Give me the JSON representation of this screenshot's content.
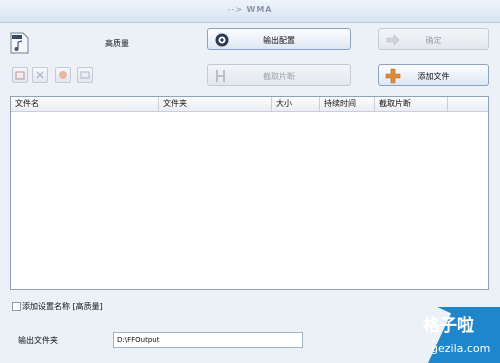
{
  "window": {
    "title_arrow": "-->",
    "title_format": "WMA"
  },
  "settings": {
    "quality_label": "高质量"
  },
  "buttons": {
    "output_config": "输出配置",
    "ok": "确定",
    "clip": "截取片断",
    "add_file": "添加文件"
  },
  "table": {
    "columns": [
      "文件名",
      "文件夹",
      "大小",
      "持续时间",
      "截取片断"
    ],
    "rows": []
  },
  "options": {
    "add_setting_name": "添加设置名称 [高质量]",
    "add_setting_name_checked": false
  },
  "output": {
    "folder_label": "输出文件夹",
    "folder_value": "D:\\FFOutput"
  },
  "watermark": {
    "cn": "格子啦",
    "en": "gezila.com"
  },
  "colors": {
    "accent": "#1f86cc",
    "window_bg": "#ecf1f8",
    "border": "#8da2c0"
  }
}
